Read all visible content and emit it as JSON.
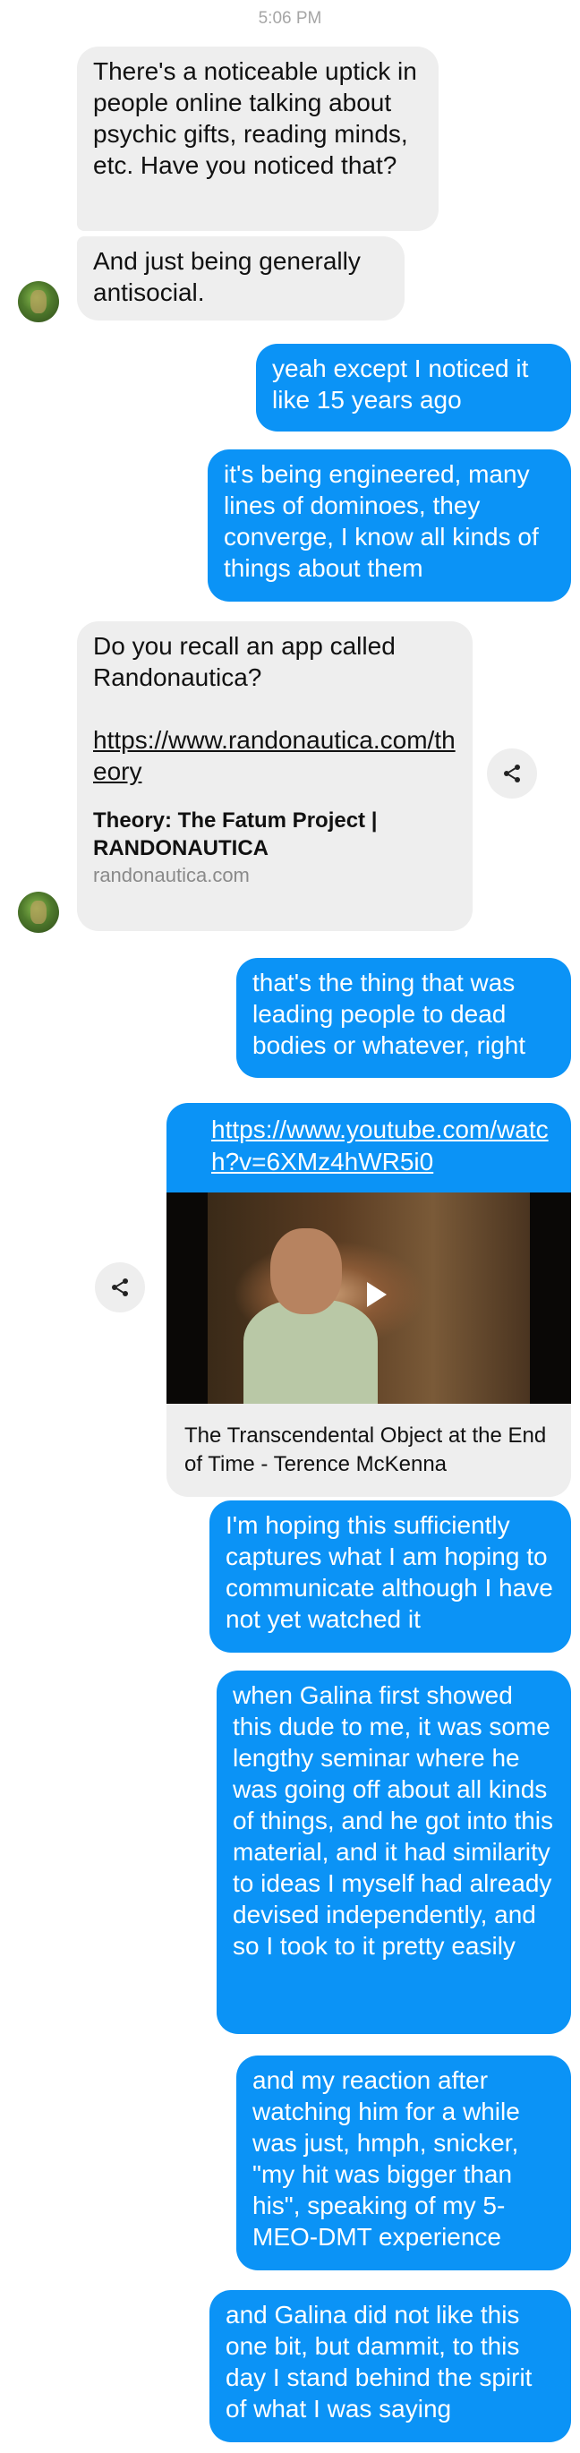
{
  "timestamp": "5:06 PM",
  "messages": {
    "m1": "There's a noticeable uptick in people online talking about psychic gifts, reading minds, etc. Have you noticed that?",
    "m2": "And just being generally antisocial.",
    "m3": "yeah except I noticed it like 15 years ago",
    "m4": "it's being engineered, many lines of dominoes, they converge, I know all kinds of things about them",
    "m5_text": "Do you recall an app called Randonautica?",
    "m5_link": "https://www.randonautica.com/theory",
    "m5_card_title": "Theory: The Fatum Project | RANDONAUTICA",
    "m5_card_domain": "randonautica.com",
    "m6": "that's the thing that was leading people to dead bodies or whatever, right",
    "m7_link": "https://www.youtube.com/watch?v=6XMz4hWR5i0",
    "m7_video_title": "The Transcendental Object at the End of Time - Terence McKenna",
    "m8": "I'm hoping this sufficiently captures what I am hoping to communicate although I have not yet watched it",
    "m9": "when Galina first showed this dude to me, it was some lengthy seminar where he was going off about all kinds of things, and he got into this material, and it had similarity to ideas I myself had already devised independently, and so I took to it pretty easily",
    "m10": "and my reaction after watching him for a while was just, hmph, snicker, \"my hit was bigger than his\", speaking of my 5-MEO-DMT experience",
    "m11": "and Galina did not like this one bit, but dammit, to this day I stand behind the spirit of what I was saying"
  },
  "colors": {
    "incoming_bubble": "#eeeeee",
    "outgoing_bubble": "#0b93f6"
  },
  "icons": {
    "share": "share-icon",
    "play": "play-icon"
  }
}
